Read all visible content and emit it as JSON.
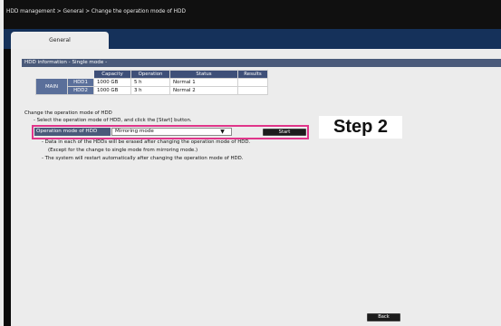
{
  "breadcrumb": "HDD management  >  General  >  Change the operation mode of HDD",
  "tab": "General",
  "hdd_info": {
    "header": "HDD information - Single mode -",
    "columns": [
      "Capacity",
      "Operation",
      "Status",
      "Results"
    ],
    "group_label": "MAIN",
    "rows": [
      {
        "name": "HDD1",
        "capacity": "1000 GB",
        "operation": "5 h",
        "status": "Normal 1",
        "results": ""
      },
      {
        "name": "HDD2",
        "capacity": "1000 GB",
        "operation": "3 h",
        "status": "Normal 2",
        "results": ""
      }
    ]
  },
  "change": {
    "title": "Change the operation mode of HDD",
    "instruction": "- Select the operation mode of HDD, and click the [Start] button.",
    "mode_label": "Operation mode of HDD",
    "mode_value": "Mirroring mode",
    "start_label": "Start",
    "note1": "- Data in each of the HDDs will be erased after changing the operation mode of HDD.",
    "note2": "(Except for the change to single mode from mirroring mode.)",
    "note3": "- The system will restart automatically after changing the operation mode of HDD."
  },
  "step_label": "Step 2",
  "back_label": "Back",
  "colors": {
    "highlight": "#e0358a",
    "header_bg": "#4a5a7a",
    "tab_band": "#15315a"
  }
}
